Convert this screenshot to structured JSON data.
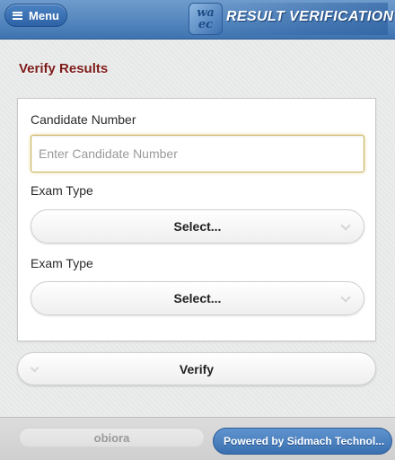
{
  "header": {
    "menu_label": "Menu",
    "logo_text_top": "wa",
    "logo_text_bottom": "ec",
    "title": "RESULT VERIFICATION"
  },
  "page": {
    "title": "Verify Results"
  },
  "form": {
    "candidate_label": "Candidate Number",
    "candidate_placeholder": "Enter Candidate Number",
    "candidate_value": "",
    "exam_type_label_1": "Exam Type",
    "exam_type_select_1": "Select...",
    "exam_type_label_2": "Exam Type",
    "exam_type_select_2": "Select...",
    "verify_label": "Verify"
  },
  "footer": {
    "user_label": "obiora",
    "powered_label": "Powered by Sidmach Technol..."
  },
  "colors": {
    "header_blue": "#3f74b1",
    "title_red": "#7b1a17",
    "input_focus": "#c9b25a"
  }
}
